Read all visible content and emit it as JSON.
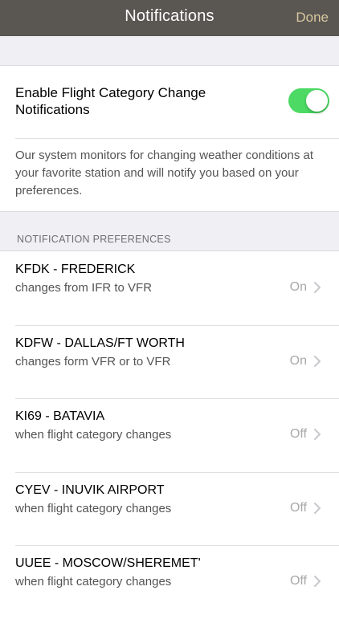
{
  "navbar": {
    "title": "Notifications",
    "done_label": "Done"
  },
  "enable": {
    "label": "Enable Flight Category Change Notifications",
    "enabled": true
  },
  "description": "Our system monitors for changing weather conditions at your favorite station and will notify you based on your preferences.",
  "preferences": {
    "header": "NOTIFICATION PREFERENCES",
    "items": [
      {
        "station": "KFDK - FREDERICK",
        "description": "changes from IFR to VFR",
        "status": "On"
      },
      {
        "station": "KDFW - DALLAS/FT WORTH",
        "description": "changes form VFR or to VFR",
        "status": "On"
      },
      {
        "station": "KI69 - BATAVIA",
        "description": "when flight category changes",
        "status": "Off"
      },
      {
        "station": "CYEV - INUVIK AIRPORT",
        "description": "when flight category changes",
        "status": "Off"
      },
      {
        "station": "UUEE - MOSCOW/SHEREMET'",
        "description": "when flight category changes",
        "status": "Off"
      }
    ]
  },
  "colors": {
    "navbar": "#5a5753",
    "done": "#d8c79f",
    "toggle_on": "#4cd964",
    "background": "#efeff4"
  }
}
